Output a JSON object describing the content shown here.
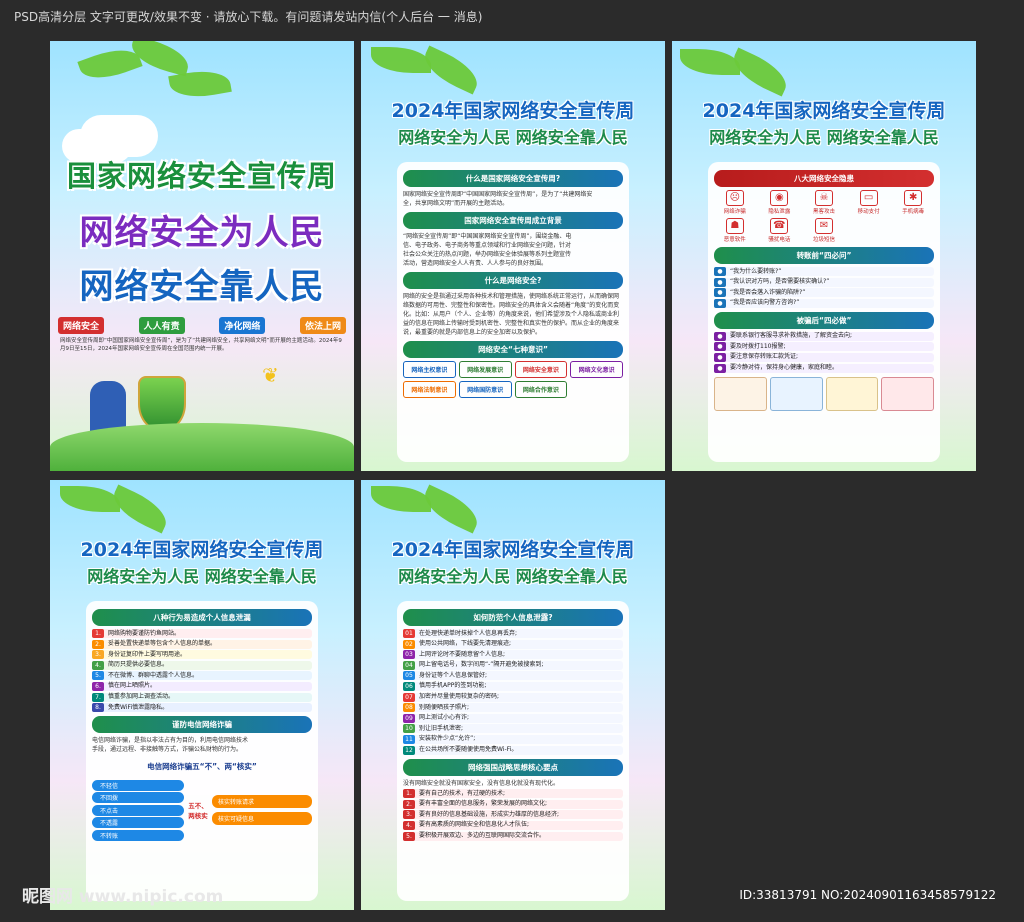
{
  "header_note": "PSD高清分层 文字可更改/效果不变 · 请放心下载。有问题请发站内信(个人后台 一 消息)",
  "poster_titles": {
    "year_title": "2024年国家网络安全宣传周",
    "slogan": "网络安全为人民 网络安全靠人民"
  },
  "p1": {
    "line1": "国家网络安全宣传周",
    "line2": "网络安全为人民",
    "line3": "网络安全靠人民",
    "chips": [
      "网络安全",
      "人人有责",
      "净化网络",
      "依法上网"
    ],
    "desc": "网络安全宣传周即“中国国家网络安全宣传周”，是为了“共建网络安全，共享网络文明”而开展的主题活动。2024年9月9日至15日，2024年国家网络安全宣传周在全国范围内统一开展。"
  },
  "p2": {
    "s1": "什么是国家网络安全宣传周?",
    "s1_text": "国家网络安全宣传周即“中国国家网络安全宣传周”，是为了“共建网络安全，共享网络文明”而开展的主题活动。",
    "s2": "国家网络安全宣传周成立背景",
    "s2_text": "“网络安全宣传周”即“中国国家网络安全宣传周”，围绕金融、电信、电子政务、电子商务等重点领域和行业网络安全问题，针对社会公众关注的热点问题，举办网络安全体验展等系列主题宣传活动，营造网络安全人人有责、人人参与的良好氛围。",
    "s3": "什么是网络安全?",
    "s3_text": "网络的安全是指通过采用各种技术和管理措施，使网络系统正常运行，从而确保网络数据的可用性、完整性和保密性。网络安全的具体含义会随着“角度”的变化而变化。比如：从用户（个人、企业等）的角度来说，他们希望涉及个人隐私或商业利益的信息在网络上传输时受到机密性、完整性和真实性的保护。而从企业的角度来说，最重要的就是内部信息上的安全加密以及保护。",
    "s4": "网络安全“七种意识”",
    "seven": [
      "网络主权意识",
      "网络发展意识",
      "网络安全意识",
      "网络文化意识",
      "网络法制意识",
      "网络国防意识",
      "网络合作意识"
    ]
  },
  "p3": {
    "s1": "八大网络安全隐患",
    "eight": [
      "网络诈骗",
      "隐私泄露",
      "黑客攻击",
      "移动支付",
      "手机病毒",
      "恶意软件",
      "骚扰电话",
      "垃圾短信"
    ],
    "s2": "转账前“四必问”",
    "asks": [
      "“我为什么要转账?”",
      "“我认识对方吗，是否需要核实确认?”",
      "“我是否会落入诈骗的陷阱?”",
      "“我是否应该向警方咨询?”"
    ],
    "s3": "被骗后“四必做”",
    "dos": [
      "要联系银行客服寻求补救措施，了解资金去向;",
      "要及时拨打110报警;",
      "要注意保存转账汇款凭证;",
      "要冷静对待，保持身心健康，家庭和睦。"
    ]
  },
  "p4": {
    "s1": "八种行为易造成个人信息泄漏",
    "items": [
      "网络购物要谨防钓鱼网站。",
      "妥善处置快递单等包含个人信息的单据。",
      "身份证复印件上要写明用途。",
      "简历只提供必要信息。",
      "不在微博、群聊中透露个人信息。",
      "慎在网上晒照片。",
      "慎重参加网上调查活动。",
      "免费WiFi慎泄露隐私。"
    ],
    "s2": "谨防电信网络诈骗",
    "s2_text": "电信网络诈骗，是指以非法占有为目的，利用电信网络技术手段，通过远程、非接触等方式，诈骗公私财物的行为。",
    "s3": "电信网络诈骗五“不”、两“核实”",
    "five": [
      "不轻信",
      "不回拨",
      "不点击",
      "不透露",
      "不转账"
    ],
    "two": [
      "核实转账请求",
      "核实可疑信息"
    ],
    "middle": "五不、两核实"
  },
  "p5": {
    "s1": "如何防范个人信息泄露?",
    "items": [
      "在处理快递单时抹掉个人信息再丢弃;",
      "使用公共网络，下线要先清理痕迹;",
      "上网评论时不要随意留个人信息;",
      "网上留电话号，数字间用“-”隔开避免被搜索到;",
      "身份证等个人信息保管好;",
      "慎用手机APP的签到功能;",
      "加密并尽量使用较复杂的密码;",
      "别随便晒孩子照片;",
      "网上测试小心有诈;",
      "别让旧手机泄密;",
      "安装软件少点“允许”;",
      "在公共场所不要随便使用免费Wi-Fi。"
    ],
    "s2": "网络强国战略思想核心要点",
    "s2_lead": "没有网络安全就没有国家安全，没有信息化就没有现代化。",
    "points": [
      "要有自己的技术，有过硬的技术;",
      "要有丰富全面的信息服务，繁荣发展的网络文化;",
      "要有良好的信息基础设施，形成实力雄厚的信息经济;",
      "要有高素质的网络安全和信息化人才队伍;",
      "要积极开展双边、多边的互联网国际交流合作。"
    ]
  },
  "watermark": {
    "left": "昵图网 www.nipic.com",
    "right": "ID:33813791 NO:20240901163458579122"
  },
  "colors": {
    "green": "#1f8f4b",
    "blue": "#1a73b8",
    "red": "#d32f2f"
  }
}
